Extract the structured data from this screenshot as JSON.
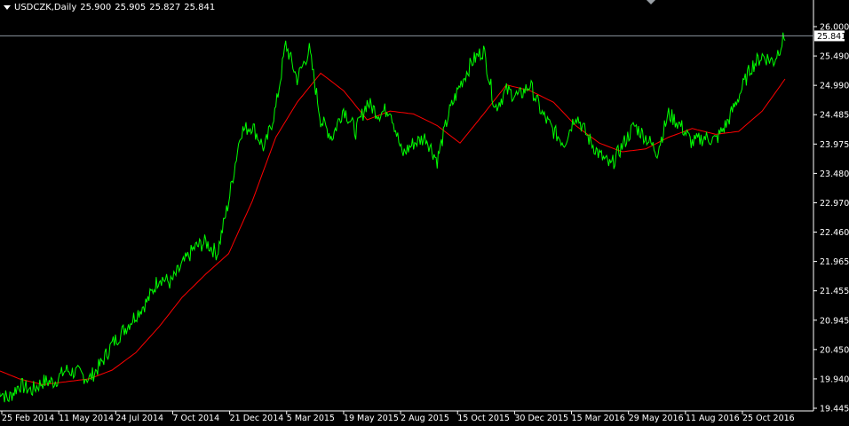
{
  "header": {
    "symbol": "USDCZK,Daily",
    "open": "25.900",
    "high": "25.905",
    "low": "25.827",
    "close": "25.841"
  },
  "current_price_label": "25.841",
  "colors": {
    "background": "#000000",
    "price_line": "#00ff00",
    "moving_average": "#ff0000",
    "axis": "#ffffff",
    "current_price_line": "#8c96a0"
  },
  "chart_data": {
    "type": "line",
    "title": "",
    "xlabel": "",
    "ylabel": "",
    "ylim": [
      19.445,
      26.0
    ],
    "grid": false,
    "y_ticks": [
      "26.000",
      "25.490",
      "24.990",
      "24.485",
      "23.975",
      "23.480",
      "22.970",
      "22.460",
      "21.965",
      "21.455",
      "20.945",
      "20.450",
      "19.940",
      "19.445"
    ],
    "x_ticks": [
      "25 Feb 2014",
      "11 May 2014",
      "24 Jul 2014",
      "7 Oct 2014",
      "21 Dec 2014",
      "5 Mar 2015",
      "19 May 2015",
      "2 Aug 2015",
      "15 Oct 2015",
      "30 Dec 2015",
      "15 Mar 2016",
      "29 May 2016",
      "11 Aug 2016",
      "25 Oct 2016"
    ],
    "series": [
      {
        "role": "price",
        "x": [
          "2014-02-20",
          "2014-03-05",
          "2014-03-20",
          "2014-04-05",
          "2014-04-20",
          "2014-05-05",
          "2014-05-20",
          "2014-06-05",
          "2014-06-20",
          "2014-07-05",
          "2014-07-20",
          "2014-08-05",
          "2014-08-20",
          "2014-09-05",
          "2014-09-20",
          "2014-10-05",
          "2014-10-20",
          "2014-11-05",
          "2014-11-20",
          "2014-12-05",
          "2014-12-20",
          "2015-01-05",
          "2015-01-20",
          "2015-02-05",
          "2015-02-20",
          "2015-03-05",
          "2015-03-20",
          "2015-04-05",
          "2015-04-20",
          "2015-05-05",
          "2015-05-20",
          "2015-06-05",
          "2015-06-20",
          "2015-07-05",
          "2015-07-20",
          "2015-08-05",
          "2015-08-20",
          "2015-09-05",
          "2015-09-20",
          "2015-10-05",
          "2015-10-20",
          "2015-11-05",
          "2015-11-20",
          "2015-12-05",
          "2015-12-20",
          "2016-01-05",
          "2016-01-20",
          "2016-02-05",
          "2016-02-20",
          "2016-03-05",
          "2016-03-20",
          "2016-04-05",
          "2016-04-20",
          "2016-05-05",
          "2016-05-20",
          "2016-06-05",
          "2016-06-20",
          "2016-07-05",
          "2016-07-20",
          "2016-08-05",
          "2016-08-20",
          "2016-09-05",
          "2016-09-20",
          "2016-10-05",
          "2016-10-20",
          "2016-11-05",
          "2016-11-20",
          "2016-12-05",
          "2016-12-20"
        ],
        "values": [
          19.8,
          19.6,
          19.85,
          19.75,
          19.9,
          19.9,
          20.1,
          20.05,
          19.95,
          20.2,
          20.55,
          20.8,
          21.05,
          21.3,
          21.7,
          21.6,
          21.9,
          22.2,
          22.3,
          22.1,
          23.0,
          24.2,
          24.3,
          23.9,
          24.6,
          25.7,
          25.1,
          25.6,
          24.4,
          24.1,
          24.6,
          24.2,
          24.7,
          24.5,
          24.6,
          23.8,
          24.0,
          24.1,
          23.7,
          24.5,
          25.0,
          25.4,
          25.6,
          24.6,
          24.9,
          24.8,
          25.0,
          24.5,
          24.2,
          24.0,
          24.5,
          24.1,
          23.8,
          23.6,
          23.95,
          24.3,
          24.1,
          23.85,
          24.5,
          24.3,
          24.0,
          24.1,
          24.05,
          24.35,
          24.8,
          25.3,
          25.5,
          25.4,
          25.85
        ]
      },
      {
        "role": "moving-average",
        "x": [
          "2014-02-20",
          "2014-03-20",
          "2014-04-20",
          "2014-05-20",
          "2014-06-20",
          "2014-07-20",
          "2014-08-20",
          "2014-09-20",
          "2014-10-20",
          "2014-11-20",
          "2014-12-20",
          "2015-01-20",
          "2015-02-20",
          "2015-03-20",
          "2015-04-20",
          "2015-05-20",
          "2015-06-20",
          "2015-07-20",
          "2015-08-20",
          "2015-09-20",
          "2015-10-20",
          "2015-11-20",
          "2015-12-20",
          "2016-01-20",
          "2016-02-20",
          "2016-03-20",
          "2016-04-20",
          "2016-05-20",
          "2016-06-20",
          "2016-07-20",
          "2016-08-20",
          "2016-09-20",
          "2016-10-20",
          "2016-11-20",
          "2016-12-20"
        ],
        "values": [
          20.1,
          19.95,
          19.85,
          19.9,
          19.95,
          20.1,
          20.4,
          20.85,
          21.35,
          21.75,
          22.1,
          23.0,
          24.1,
          24.7,
          25.2,
          24.9,
          24.4,
          24.55,
          24.5,
          24.3,
          24.0,
          24.5,
          25.0,
          24.9,
          24.7,
          24.3,
          24.0,
          23.85,
          23.9,
          24.1,
          24.25,
          24.15,
          24.2,
          24.55,
          25.1
        ]
      }
    ]
  }
}
